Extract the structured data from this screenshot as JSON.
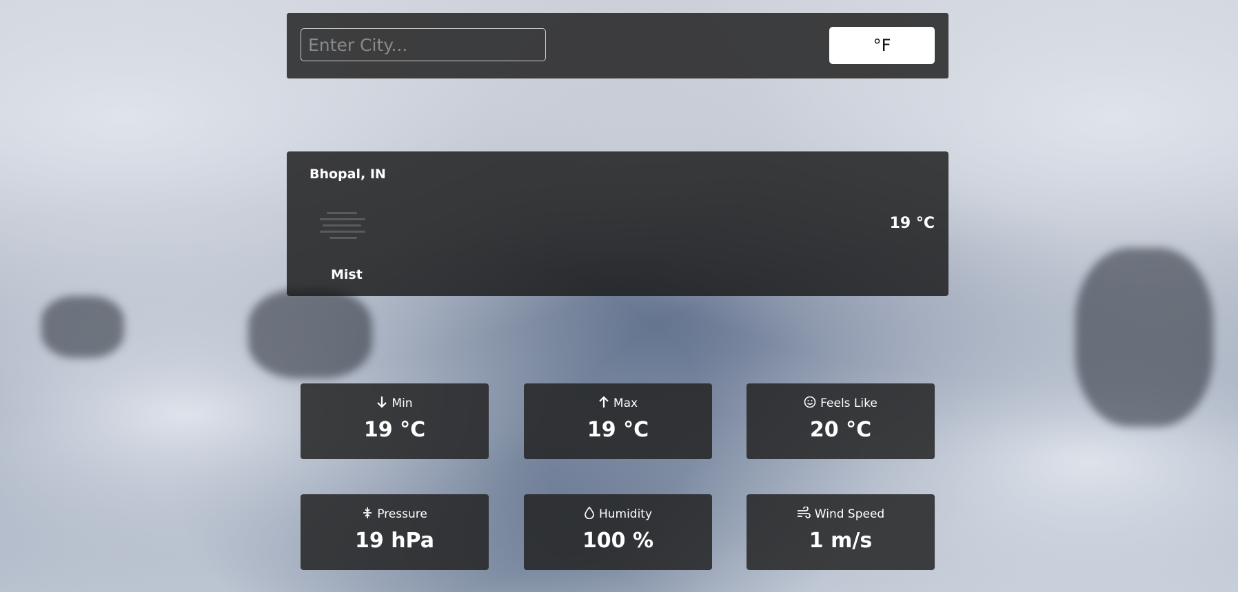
{
  "search": {
    "placeholder": "Enter City...",
    "value": "",
    "unit_toggle_label": "°F"
  },
  "current": {
    "location": "Bhopal, IN",
    "condition": "Mist",
    "temperature": "19 °C",
    "icon": "mist-icon"
  },
  "stats": [
    {
      "label": "Min",
      "value": "19 °C",
      "icon": "arrow-down-icon"
    },
    {
      "label": "Max",
      "value": "19 °C",
      "icon": "arrow-up-icon"
    },
    {
      "label": "Feels Like",
      "value": "20 °C",
      "icon": "smiley-icon"
    },
    {
      "label": "Pressure",
      "value": "19 hPa",
      "icon": "pressure-icon"
    },
    {
      "label": "Humidity",
      "value": "100 %",
      "icon": "droplet-icon"
    },
    {
      "label": "Wind Speed",
      "value": "1 m/s",
      "icon": "wind-icon"
    }
  ],
  "colors": {
    "panel": "#282828",
    "text": "#ffffff",
    "button_bg": "#ffffff"
  }
}
